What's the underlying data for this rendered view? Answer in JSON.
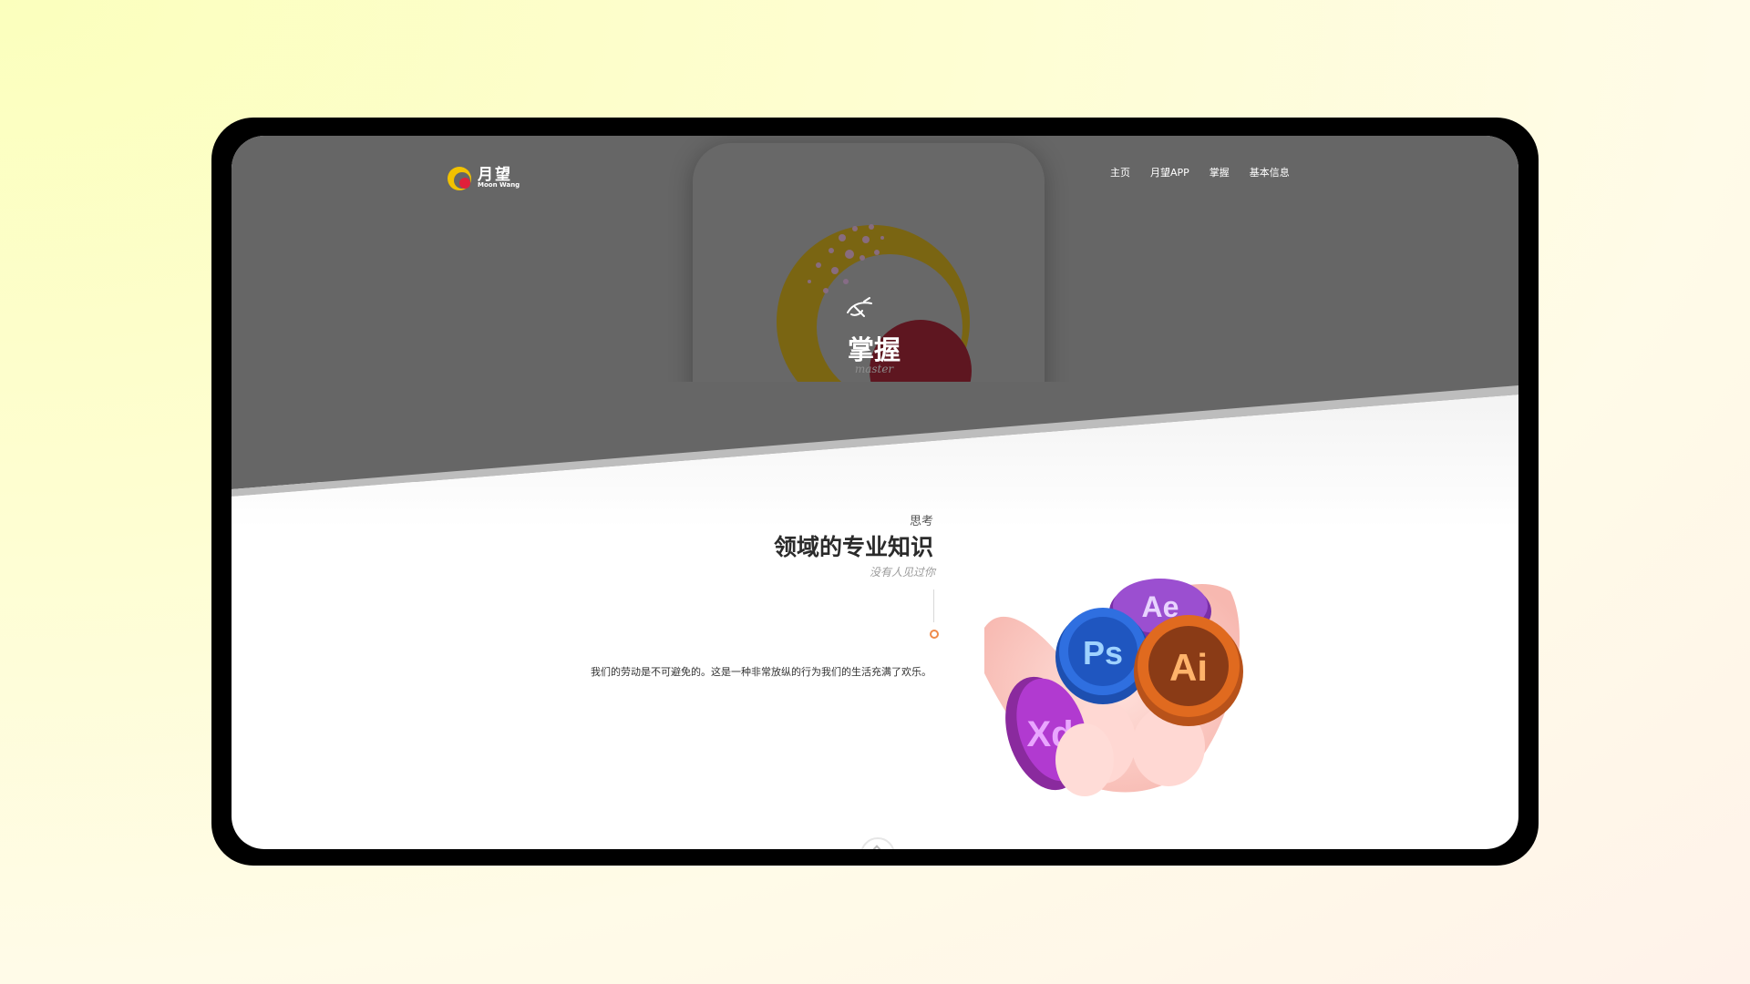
{
  "brand": {
    "name_cn": "月望",
    "name_en": "Moon Wang"
  },
  "nav": {
    "items": [
      {
        "label": "主页"
      },
      {
        "label": "月望APP"
      },
      {
        "label": "掌握"
      },
      {
        "label": "基本信息"
      }
    ]
  },
  "hero": {
    "title": "掌握",
    "subtitle": "master",
    "icon": "plane-doodle-icon"
  },
  "section": {
    "eyebrow": "思考",
    "heading": "领域的专业知识",
    "subheading": "没有人见过你",
    "body": "我们的劳动是不可避免的。这是一种非常放纵的行为我们的生活充满了欢乐。"
  },
  "illustration": {
    "coins": [
      {
        "label": "Ae",
        "color": "#9b4fd0"
      },
      {
        "label": "Ps",
        "color": "#2f6fe0"
      },
      {
        "label": "Ai",
        "color": "#e06a1f"
      },
      {
        "label": "Xd",
        "color": "#b13ad0"
      }
    ],
    "icon": "hand-holding-coins-icon"
  },
  "colors": {
    "hero_bg": "#666666",
    "accent_yellow": "#f2c200",
    "accent_red": "#e0203a",
    "timeline_orange": "#ef8a4a"
  },
  "scroll_icon": "chevron-up-icon"
}
